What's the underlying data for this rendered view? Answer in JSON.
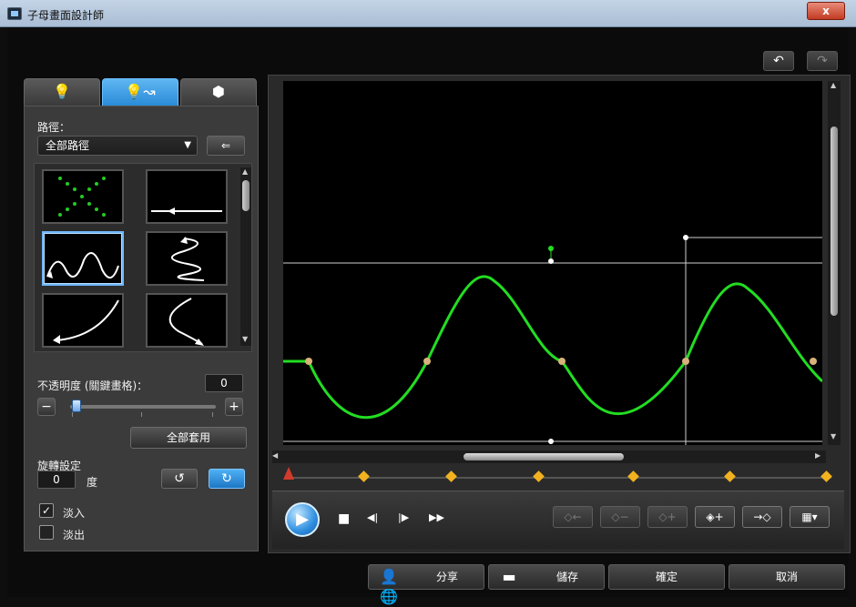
{
  "window": {
    "title": "子母畫面設計師",
    "close_glyph": "x"
  },
  "toolbar": {
    "undo_glyph": "↶",
    "redo_glyph": "↷"
  },
  "tabs": [
    {
      "name": "light-tab",
      "glyph": "💡"
    },
    {
      "name": "light-path-tab",
      "glyph": "💡↝"
    },
    {
      "name": "mask-tab",
      "glyph": "⬢"
    }
  ],
  "path": {
    "label": "路徑：",
    "selected": "全部路徑",
    "import_glyph": "⇐"
  },
  "opacity": {
    "label": "不透明度 (關鍵畫格)：",
    "value": "0",
    "minus": "−",
    "plus": "+",
    "apply_all": "全部套用"
  },
  "rotation": {
    "label": "旋轉設定",
    "value": "0",
    "unit": "度",
    "ccw_glyph": "↺",
    "cw_glyph": "↻"
  },
  "fade": {
    "fade_in": "淡入",
    "fade_out": "淡出",
    "fade_in_checked": true,
    "fade_out_checked": false,
    "check_glyph": "✓"
  },
  "playback": {
    "play": "▶",
    "stop": "■",
    "prev_frame": "◀|",
    "next_frame": "|▶",
    "fast_forward": "▶▶"
  },
  "keyframe_buttons": [
    {
      "name": "keyframe-prev",
      "label": "◇←",
      "enabled": false
    },
    {
      "name": "keyframe-remove",
      "label": "◇−",
      "enabled": false
    },
    {
      "name": "keyframe-add",
      "label": "◇+",
      "enabled": false
    },
    {
      "name": "keyframe-duplicate",
      "label": "◈+",
      "enabled": true
    },
    {
      "name": "keyframe-next",
      "label": "→◇",
      "enabled": true
    },
    {
      "name": "view-options",
      "label": "▦▾",
      "enabled": true
    }
  ],
  "timeline": {
    "keyframe_count": 7
  },
  "footer": {
    "share": "分享",
    "save": "儲存",
    "ok": "確定",
    "cancel": "取消"
  },
  "colors": {
    "accent": "#2a8bd8",
    "curve": "#22dd22",
    "keyframe": "#f2b21f"
  }
}
